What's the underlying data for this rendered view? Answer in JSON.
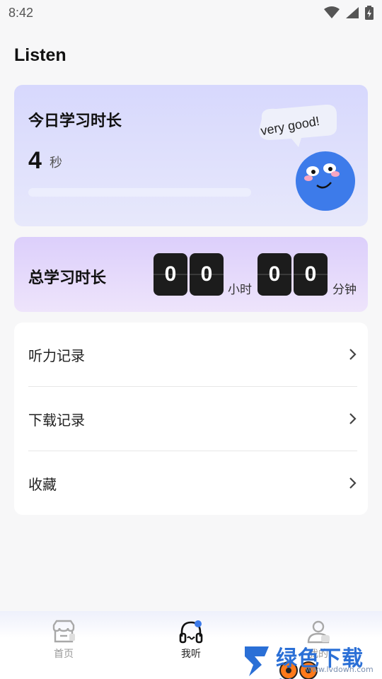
{
  "status_bar": {
    "time": "8:42"
  },
  "page": {
    "title": "Listen"
  },
  "today": {
    "title": "今日学习时长",
    "value": "4",
    "unit": "秒",
    "bubble": "very good!",
    "progress": 0
  },
  "total": {
    "title": "总学习时长",
    "hours_digits": [
      "0",
      "0"
    ],
    "hours_unit": "小时",
    "minutes_digits": [
      "0",
      "0"
    ],
    "minutes_unit": "分钟"
  },
  "menu": [
    {
      "label": "听力记录"
    },
    {
      "label": "下载记录"
    },
    {
      "label": "收藏"
    }
  ],
  "nav": [
    {
      "label": "首页",
      "icon": "store-icon"
    },
    {
      "label": "我听",
      "icon": "headphones-icon",
      "active": true
    },
    {
      "label": "我的",
      "icon": "user-icon"
    }
  ],
  "watermark": {
    "brand": "绿色下载站",
    "url": "www.lvdown.com"
  },
  "colors": {
    "accent": "#3d7bea",
    "card_today": "#d7d8fd",
    "card_total": "#dccffb",
    "digit_bg": "#1c1c1c"
  }
}
